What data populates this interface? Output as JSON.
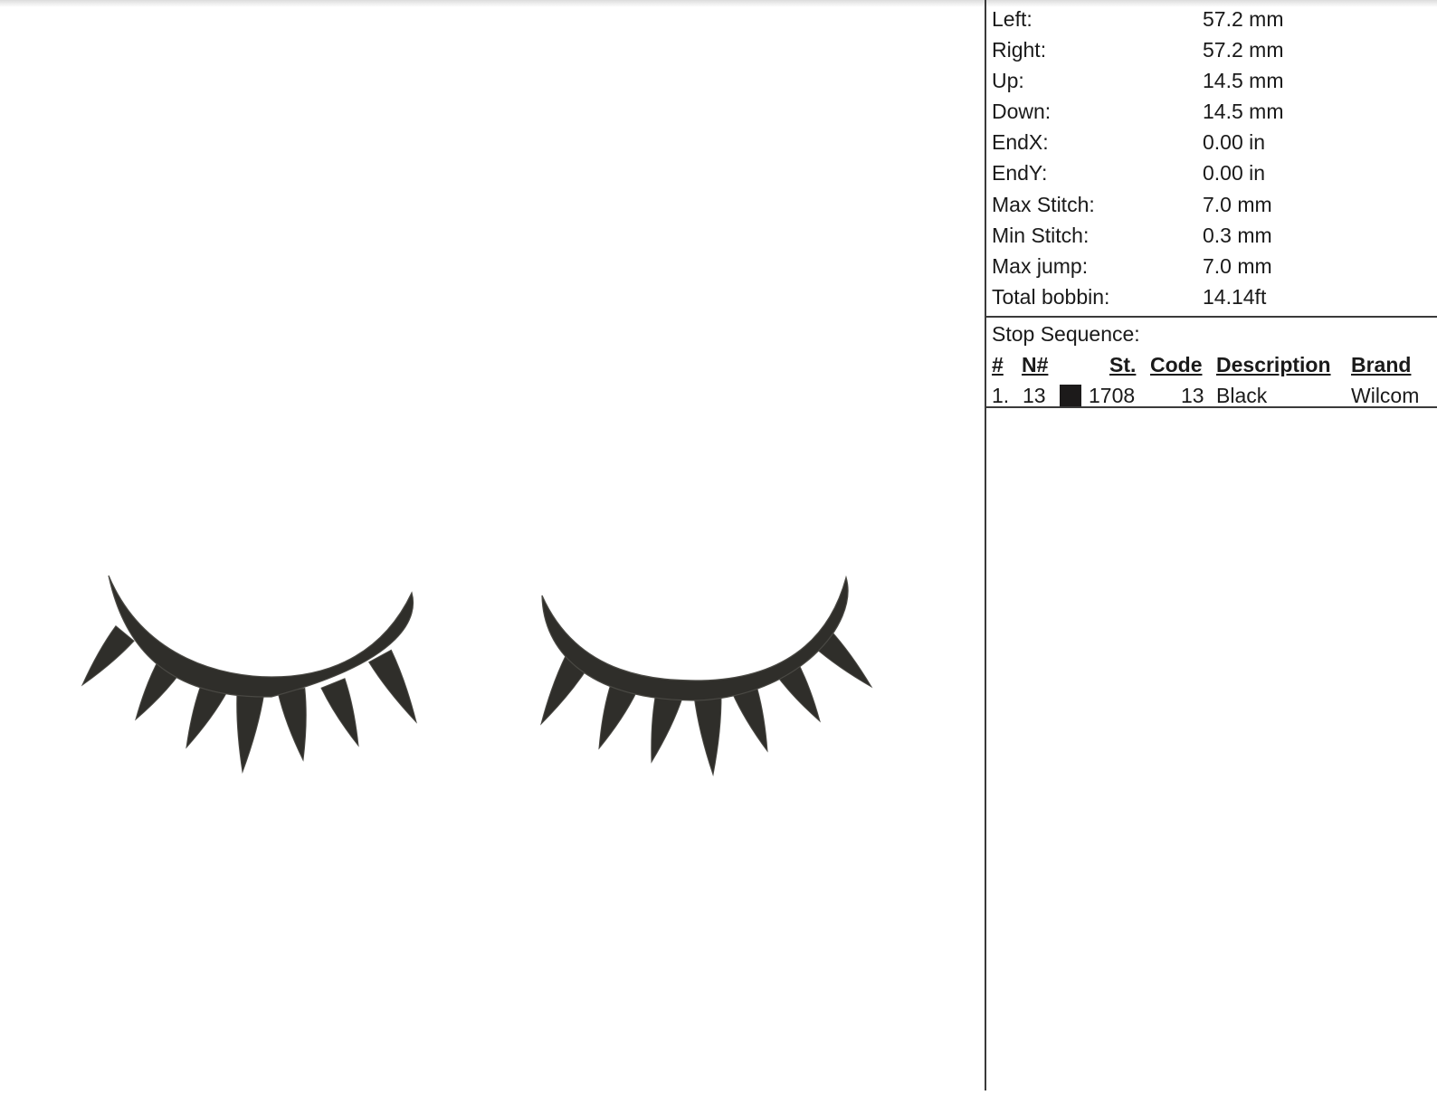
{
  "stats": [
    {
      "label": "Left:",
      "value": "57.2 mm"
    },
    {
      "label": "Right:",
      "value": "57.2 mm"
    },
    {
      "label": "Up:",
      "value": "14.5 mm"
    },
    {
      "label": "Down:",
      "value": "14.5 mm"
    },
    {
      "label": "EndX:",
      "value": "0.00 in"
    },
    {
      "label": "EndY:",
      "value": "0.00 in"
    },
    {
      "label": "Max Stitch:",
      "value": "7.0 mm"
    },
    {
      "label": "Min Stitch:",
      "value": "0.3 mm"
    },
    {
      "label": "Max jump:",
      "value": "7.0 mm"
    },
    {
      "label": "Total bobbin:",
      "value": "14.14ft"
    }
  ],
  "stop_sequence": {
    "title": "Stop Sequence:",
    "headers": {
      "index": "#",
      "needle": "N#",
      "stitches": "St.",
      "code": "Code",
      "description": "Description",
      "brand": "Brand"
    },
    "rows": [
      {
        "index": "1.",
        "needle": "13",
        "swatch_color": "#1c1a1a",
        "stitches": "1708",
        "code": "13",
        "description": "Black",
        "brand": "Wilcom"
      }
    ]
  },
  "design": {
    "thread_color": "#2f2e2a",
    "highlight_color": "#4a4944"
  }
}
